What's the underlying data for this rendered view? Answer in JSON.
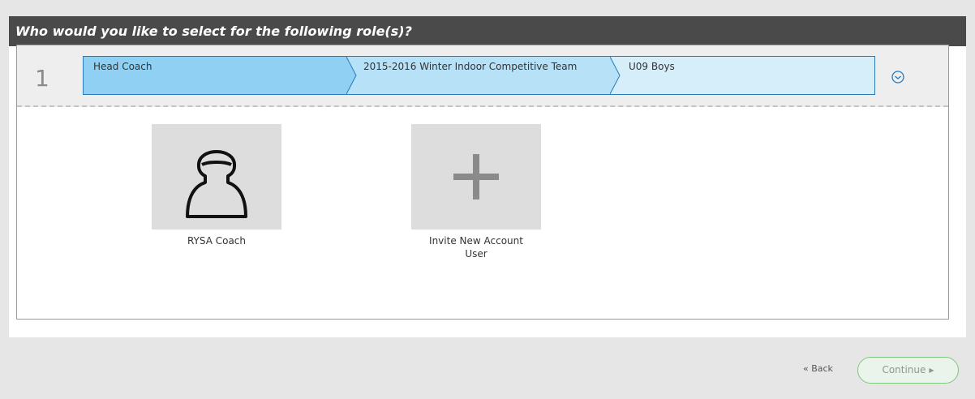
{
  "header": {
    "title": "Who would you like to select for the following role(s)?"
  },
  "role": {
    "number": "1",
    "breadcrumbs": [
      {
        "label": "Head Coach"
      },
      {
        "label": "2015-2016 Winter Indoor Competitive Team"
      },
      {
        "label": "U09 Boys"
      }
    ],
    "collapse_icon": "collapse-circle-icon"
  },
  "candidates": [
    {
      "label": "RYSA Coach",
      "icon": "person-avatar-icon"
    },
    {
      "label": "Invite New Account User",
      "icon": "plus-icon"
    }
  ],
  "footer": {
    "back_label": "« Back",
    "continue_label": "Continue",
    "continue_icon": "triangle-right-icon"
  },
  "colors": {
    "header_bg": "#4a4a4a",
    "crumb_1": "#8fd0f3",
    "crumb_2": "#b7e1f7",
    "crumb_3": "#d6eefa",
    "crumb_border": "#2a7ab8",
    "continue_border": "#7fc77f"
  }
}
